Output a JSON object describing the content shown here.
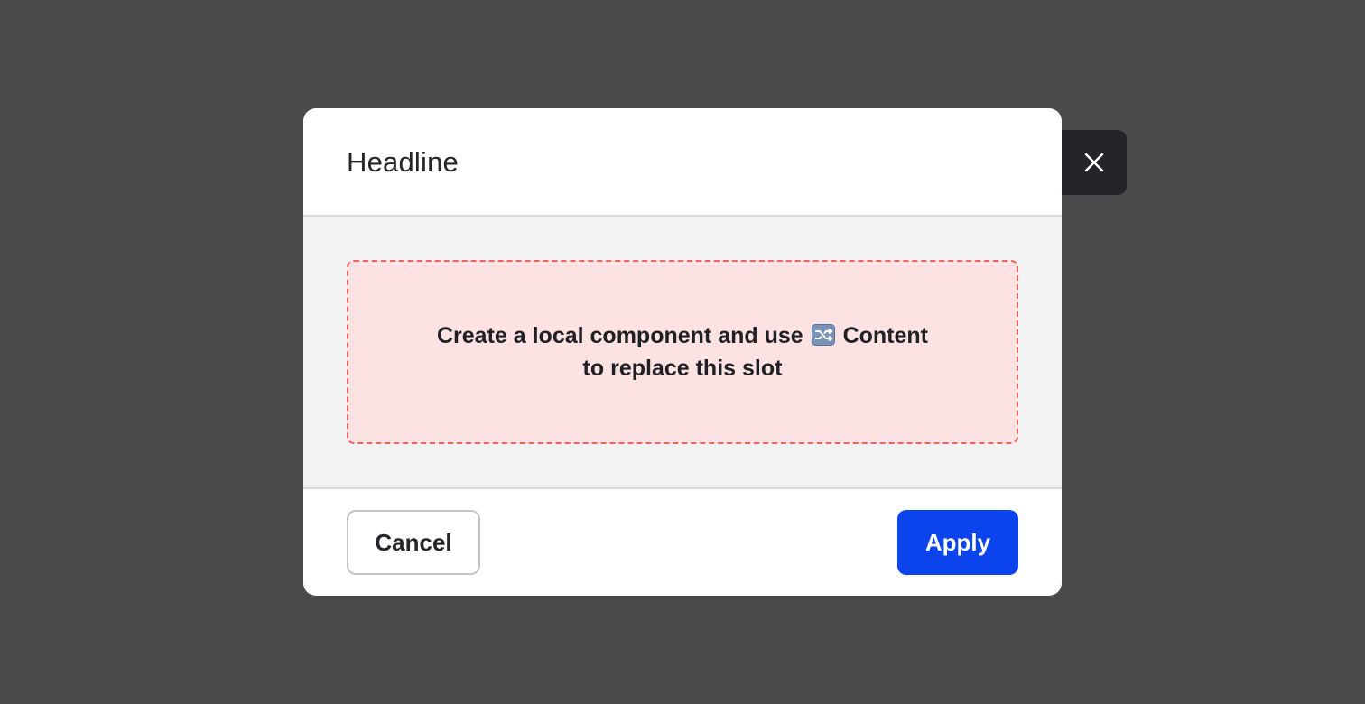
{
  "dialog": {
    "title": "Headline",
    "slot": {
      "text_before_icon": "Create a local component and use",
      "icon": "shuffle-icon",
      "text_after_icon": "Content",
      "text_line2": "to replace this slot"
    },
    "cancel_label": "Cancel",
    "apply_label": "Apply",
    "close_icon": "close-icon"
  },
  "colors": {
    "overlay": "#4a4a4a",
    "primary": "#0b44ec",
    "slot_background": "#fde2e4",
    "slot_border": "#ef6461",
    "body_background": "#f2f2f4"
  }
}
